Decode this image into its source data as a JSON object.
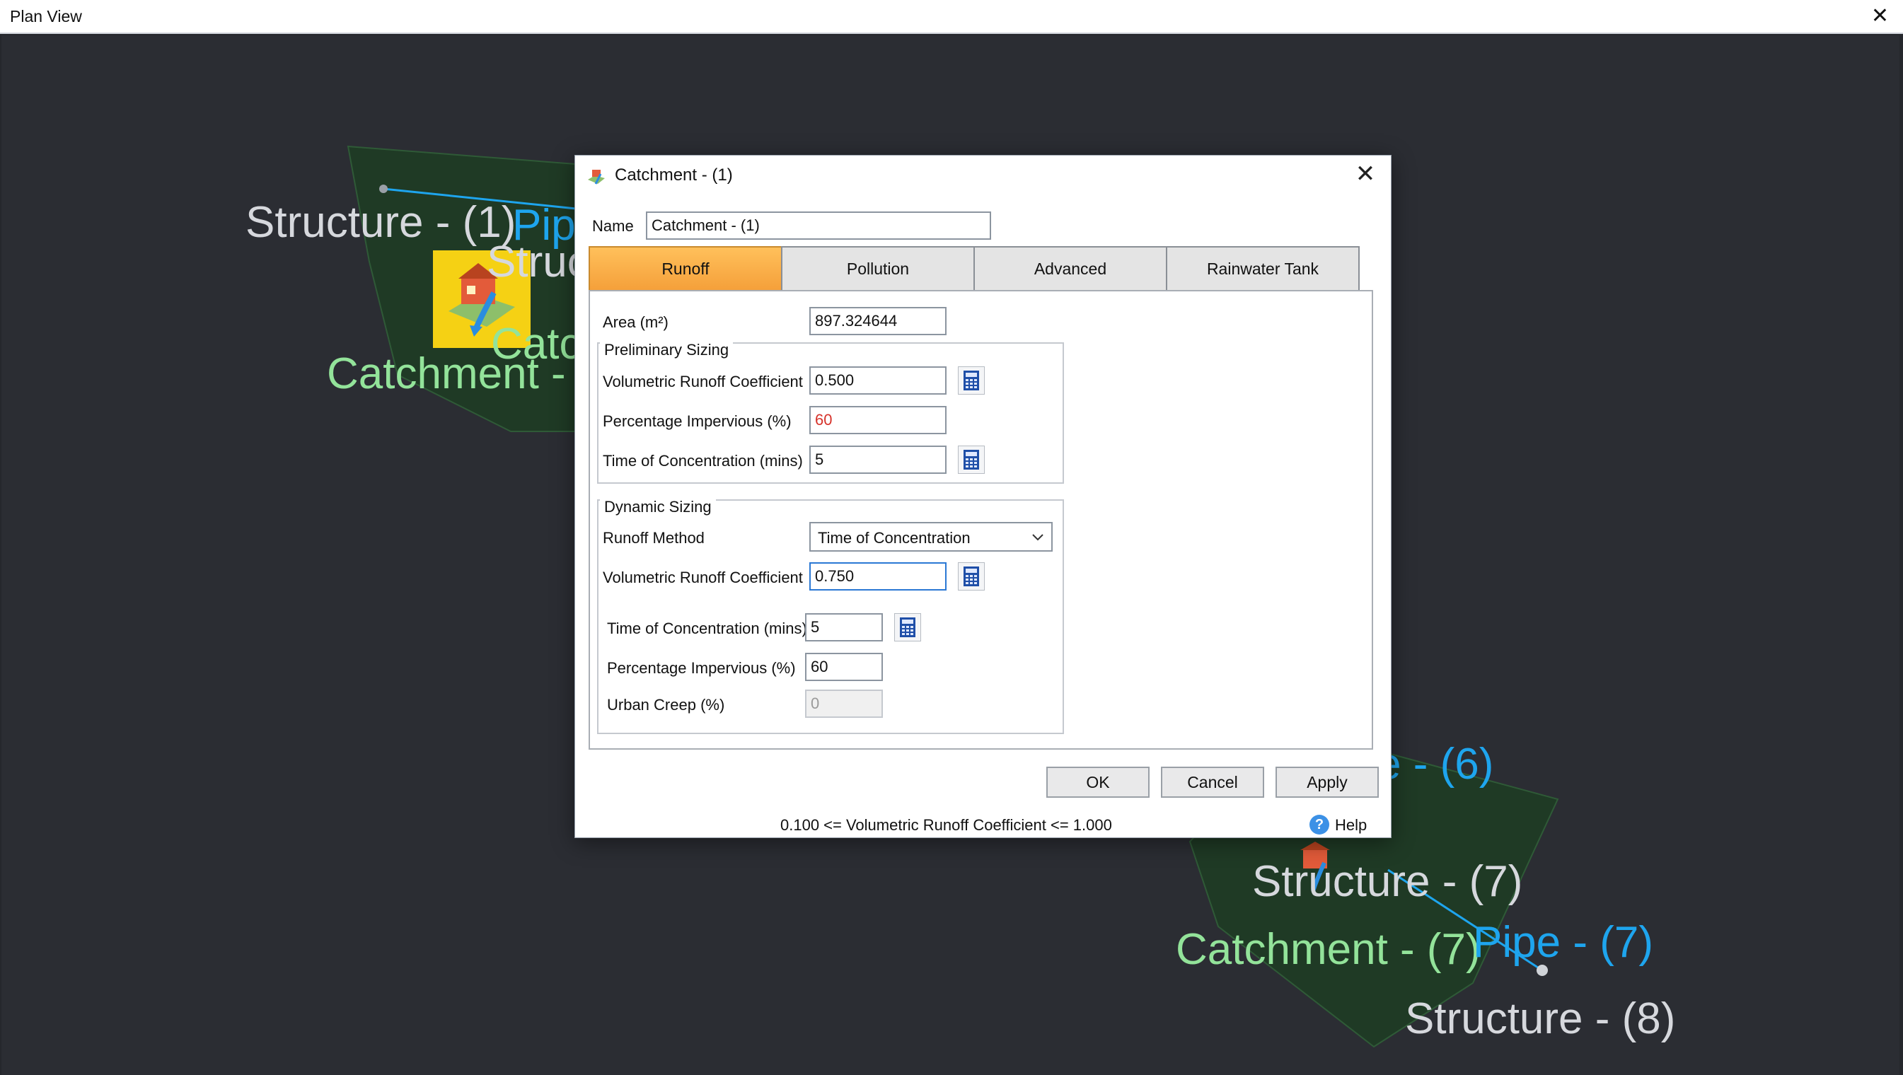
{
  "window": {
    "title": "Plan View",
    "close_glyph": "✕"
  },
  "plan": {
    "labels": [
      {
        "id": "structure-1",
        "text": "Structure - (1)",
        "kind": "structure"
      },
      {
        "id": "pipe-1",
        "text": "Pip",
        "kind": "pipe"
      },
      {
        "id": "struc-partial",
        "text": "Struc",
        "kind": "structure"
      },
      {
        "id": "catchment-1",
        "text": "Catchment -",
        "kind": "catchment"
      },
      {
        "id": "catc-partial",
        "text": "Catc",
        "kind": "catchment"
      },
      {
        "id": "pipe-6",
        "text": "e - (6)",
        "kind": "pipe"
      },
      {
        "id": "structure-7",
        "text": "Structure - (7)",
        "kind": "structure"
      },
      {
        "id": "catchment-7",
        "text": "Catchment - (7)",
        "kind": "catchment"
      },
      {
        "id": "pipe-7",
        "text": "Pipe - (7)",
        "kind": "pipe"
      },
      {
        "id": "structure-8",
        "text": "Structure - (8)",
        "kind": "structure"
      }
    ],
    "colors": {
      "background": "#2b2d33",
      "catchment_fill": "#1f3a25",
      "structure_text": "#d6d8dd",
      "catchment_text": "#93e39a",
      "pipe": "#1ea5ee",
      "icon_bg": "#f5d114"
    }
  },
  "dialog": {
    "title": "Catchment - (1)",
    "icon": "catchment-icon",
    "close_glyph": "✕",
    "name_label": "Name",
    "name_value": "Catchment - (1)",
    "tabs": [
      {
        "label": "Runoff",
        "active": true
      },
      {
        "label": "Pollution",
        "active": false
      },
      {
        "label": "Advanced",
        "active": false
      },
      {
        "label": "Rainwater Tank",
        "active": false
      }
    ],
    "runoff": {
      "area_label": "Area (m²)",
      "area_value": "897.324644",
      "preliminary": {
        "title": "Preliminary Sizing",
        "vrc_label": "Volumetric Runoff Coefficient",
        "vrc_value": "0.500",
        "pct_label": "Percentage Impervious (%)",
        "pct_value": "60",
        "toc_label": "Time of Concentration (mins)",
        "toc_value": "5"
      },
      "dynamic": {
        "title": "Dynamic Sizing",
        "method_label": "Runoff Method",
        "method_value": "Time of Concentration",
        "vrc_label": "Volumetric Runoff Coefficient",
        "vrc_value": "0.750",
        "toc_label": "Time of Concentration (mins)",
        "toc_value": "5",
        "pct_label": "Percentage Impervious (%)",
        "pct_value": "60",
        "creep_label": "Urban Creep (%)",
        "creep_value": "0"
      }
    },
    "buttons": {
      "ok": "OK",
      "cancel": "Cancel",
      "apply": "Apply"
    },
    "hint": "0.100 <= Volumetric Runoff Coefficient <= 1.000",
    "help_label": "Help",
    "help_glyph": "?"
  }
}
